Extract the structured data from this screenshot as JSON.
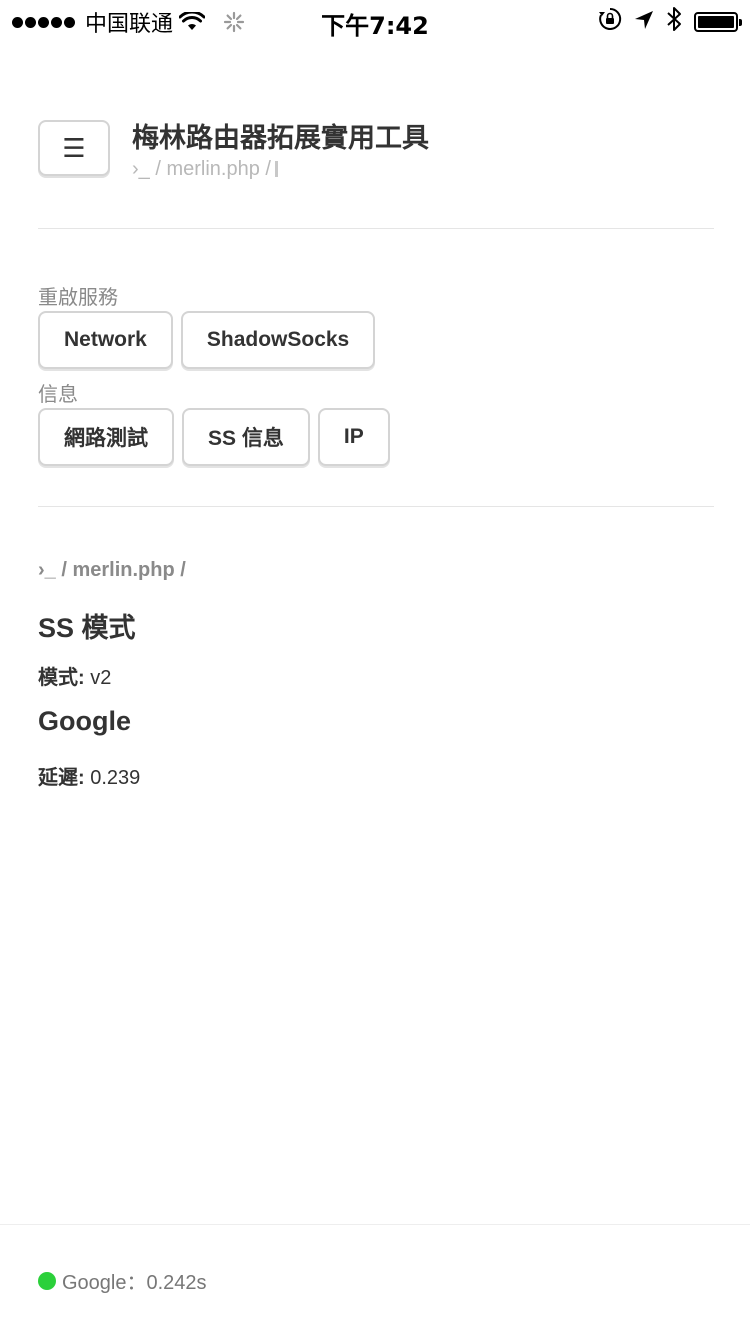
{
  "status_bar": {
    "carrier": "中国联通",
    "time": "下午7:42"
  },
  "header": {
    "menu_icon": "☰",
    "title": "梅林路由器拓展實用工具",
    "subtitle": "›_ / merlin.php /"
  },
  "sections": {
    "restart": {
      "label": "重啟服務",
      "buttons": [
        "Network",
        "ShadowSocks"
      ]
    },
    "info": {
      "label": "信息",
      "buttons": [
        "網路測試",
        "SS 信息",
        "IP"
      ]
    }
  },
  "content": {
    "path": "›_ / merlin.php /",
    "ss_heading": "SS 模式",
    "mode_label": "模式:",
    "mode_value": "v2",
    "google_heading": "Google",
    "latency_label": "延遲:",
    "latency_value": "0.239"
  },
  "footer": {
    "status_color": "#2bd03a",
    "text": "Google：0.242s"
  }
}
